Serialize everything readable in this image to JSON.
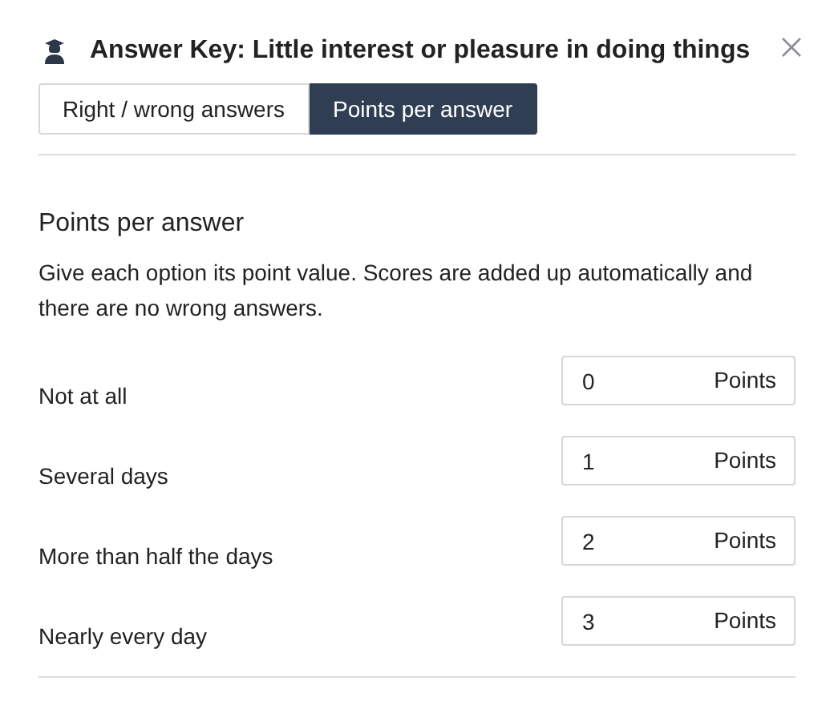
{
  "dialog": {
    "title": "Answer Key: Little interest or pleasure in doing things"
  },
  "tabs": [
    {
      "label": "Right / wrong answers",
      "selected": false
    },
    {
      "label": "Points per answer",
      "selected": true
    }
  ],
  "section": {
    "heading": "Points per answer",
    "description": "Give each option its point value. Scores are added up automatically and there are no wrong answers."
  },
  "options": [
    {
      "label": "Not at all",
      "value": "0",
      "unit": "Points"
    },
    {
      "label": "Several days",
      "value": "1",
      "unit": "Points"
    },
    {
      "label": "More than half the days",
      "value": "2",
      "unit": "Points"
    },
    {
      "label": "Nearly every day",
      "value": "3",
      "unit": "Points"
    }
  ]
}
